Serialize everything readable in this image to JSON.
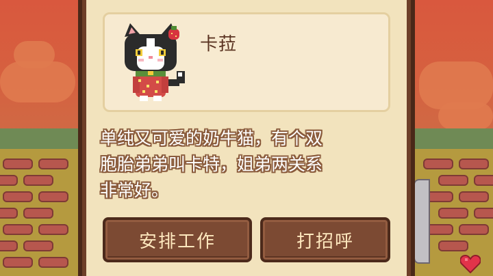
{
  "character": {
    "name": "卡菈",
    "description_lines": [
      "单纯又可爱的奶牛猫，有个双",
      "胞胎弟弟叫卡特，姐弟两关系",
      "非常好。"
    ],
    "portrait_icon": "tuxedo-cat-with-strawberry-dress"
  },
  "actions": {
    "assign_work_label": "安排工作",
    "greet_label": "打招呼"
  },
  "icons": {
    "heart": "heart-icon"
  },
  "colors": {
    "panel_frame": "#6e3f28",
    "panel_background": "#f2e3bd",
    "button": "#7c4a33",
    "button_text": "#ffe9bf",
    "heart": "#e2334a"
  }
}
